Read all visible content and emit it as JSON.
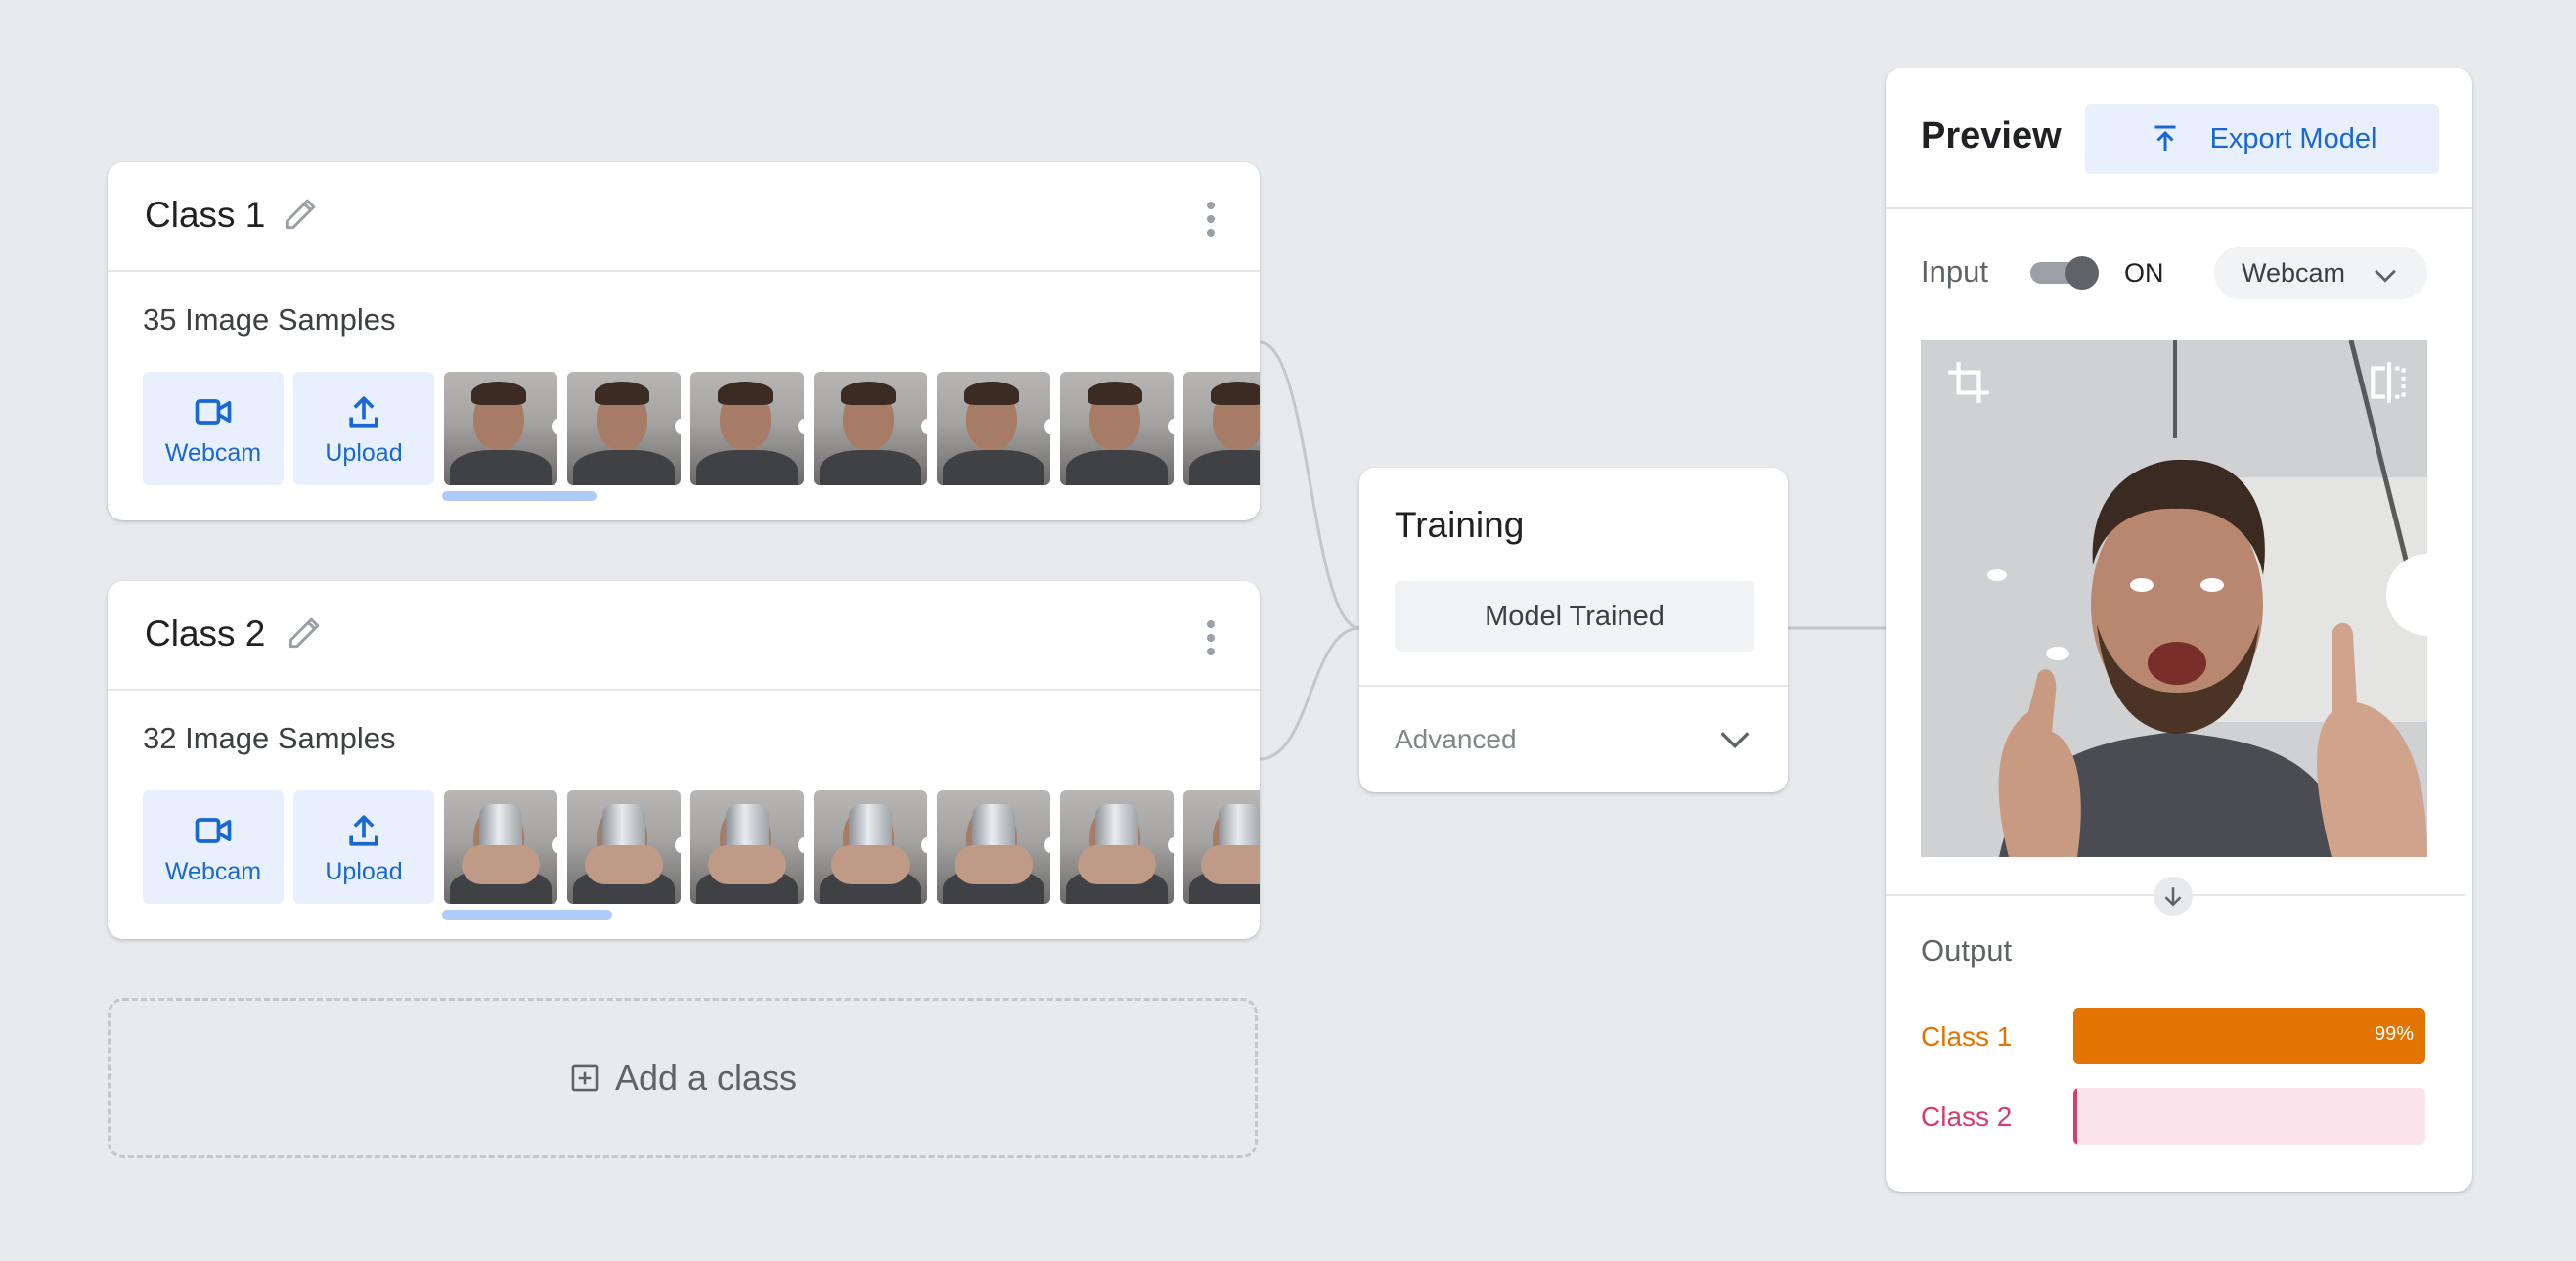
{
  "classes": [
    {
      "name": "Class 1",
      "samples_label": "35 Image Samples",
      "webcam_label": "Webcam",
      "upload_label": "Upload"
    },
    {
      "name": "Class 2",
      "samples_label": "32 Image Samples",
      "webcam_label": "Webcam",
      "upload_label": "Upload"
    }
  ],
  "add_class_label": "Add a class",
  "training": {
    "title": "Training",
    "status_button": "Model Trained",
    "advanced_label": "Advanced"
  },
  "preview": {
    "title": "Preview",
    "export_label": "Export Model",
    "input_label": "Input",
    "toggle_state": "ON",
    "source_label": "Webcam",
    "output_label": "Output",
    "results": [
      {
        "name": "Class 1",
        "percent_text": "99%",
        "confidence": 0.99,
        "color": "#e37400",
        "track_color": "#e37400"
      },
      {
        "name": "Class 2",
        "percent_text": "",
        "confidence": 0.01,
        "color": "#d93b6b",
        "track_color": "#fce4ec"
      }
    ]
  },
  "colors": {
    "accent_blue": "#1967d2",
    "tile_blue": "#e8f0fe",
    "background": "#e8eaed"
  }
}
